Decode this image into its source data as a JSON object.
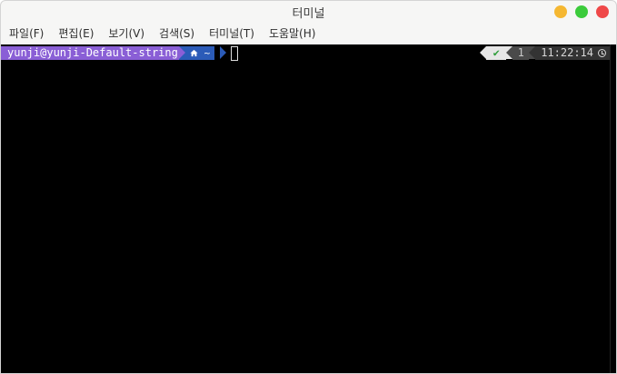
{
  "window": {
    "title": "터미널"
  },
  "menu": [
    {
      "label": "파일(F)"
    },
    {
      "label": "편집(E)"
    },
    {
      "label": "보기(V)"
    },
    {
      "label": "검색(S)"
    },
    {
      "label": "터미널(T)"
    },
    {
      "label": "도움말(H)"
    }
  ],
  "prompt": {
    "user_host": "yunji@yunji-Default-string",
    "home_icon": "home-icon",
    "directory": "~",
    "status_icon": "checkmark-icon",
    "status_symbol": "✔",
    "history_count": "1",
    "time": "11:22:14",
    "time_icon": "clock-icon"
  },
  "colors": {
    "user_segment": "#8a5fd6",
    "dir_segment": "#2b5bb8",
    "terminal_bg": "#000000",
    "status_ok": "#2e9d3a"
  }
}
